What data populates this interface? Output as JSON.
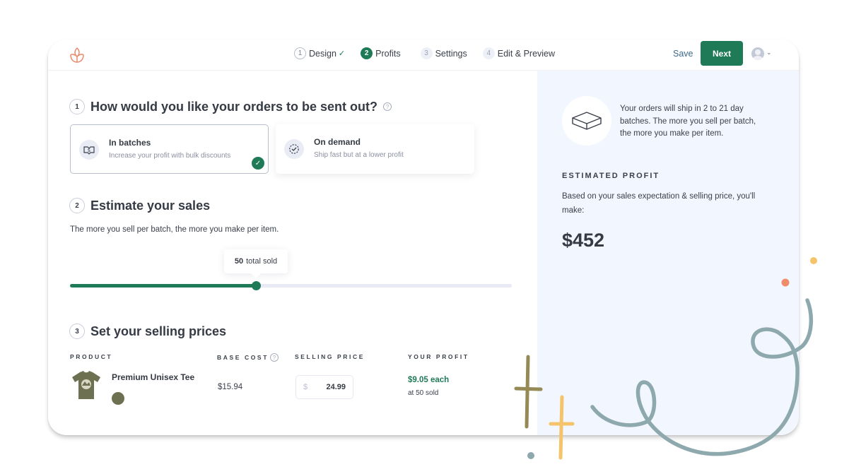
{
  "header": {
    "steps": [
      {
        "number": "1",
        "label": "Design",
        "state": "done"
      },
      {
        "number": "2",
        "label": "Profits",
        "state": "active"
      },
      {
        "number": "3",
        "label": "Settings",
        "state": "todo"
      },
      {
        "number": "4",
        "label": "Edit & Preview",
        "state": "todo"
      }
    ],
    "save_label": "Save",
    "next_label": "Next",
    "check_glyph": "✓",
    "chevron_glyph": "⌄"
  },
  "section1": {
    "number": "1",
    "title": "How would you like your orders to be sent out?",
    "help_glyph": "?",
    "options": [
      {
        "title": "In batches",
        "subtitle": "Increase your profit with bulk discounts",
        "selected": true,
        "icon": "money-bill-icon"
      },
      {
        "title": "On demand",
        "subtitle": "Ship fast but at a lower profit",
        "selected": false,
        "icon": "clock-check-icon"
      }
    ],
    "check_glyph": "✓"
  },
  "section2": {
    "number": "2",
    "title": "Estimate your sales",
    "description": "The more you sell per batch, the more you make per item.",
    "slider": {
      "value": 50,
      "value_label": "50",
      "suffix": "total sold",
      "fraction": 0.42
    }
  },
  "section3": {
    "number": "3",
    "title": "Set your selling prices",
    "columns": [
      "PRODUCT",
      "BASE COST",
      "SELLING PRICE",
      "YOUR PROFIT"
    ],
    "help_glyph": "?",
    "rows": [
      {
        "product": "Premium Unisex Tee",
        "color_swatch": "#6e7151",
        "base_cost": "$15.94",
        "currency": "$",
        "selling_price": "24.99",
        "profit_each": "$9.05 each",
        "profit_at": "at 50 sold"
      }
    ]
  },
  "sidepanel": {
    "ship_text": "Your orders will ship in 2 to 21 day batches. The more you sell per batch, the more you make per item.",
    "estimated_label": "ESTIMATED PROFIT",
    "estimated_desc": "Based on your sales expectation & selling price, you'll make:",
    "estimated_value": "$452"
  },
  "colors": {
    "brand_green": "#1f7a57",
    "logo_orange": "#e8896a",
    "panel_bg": "#f2f6fe",
    "doodle_teal": "#8ea9ad",
    "doodle_olive": "#958a55",
    "doodle_yellow": "#f5c46a",
    "doodle_coral": "#ef8c6a"
  }
}
